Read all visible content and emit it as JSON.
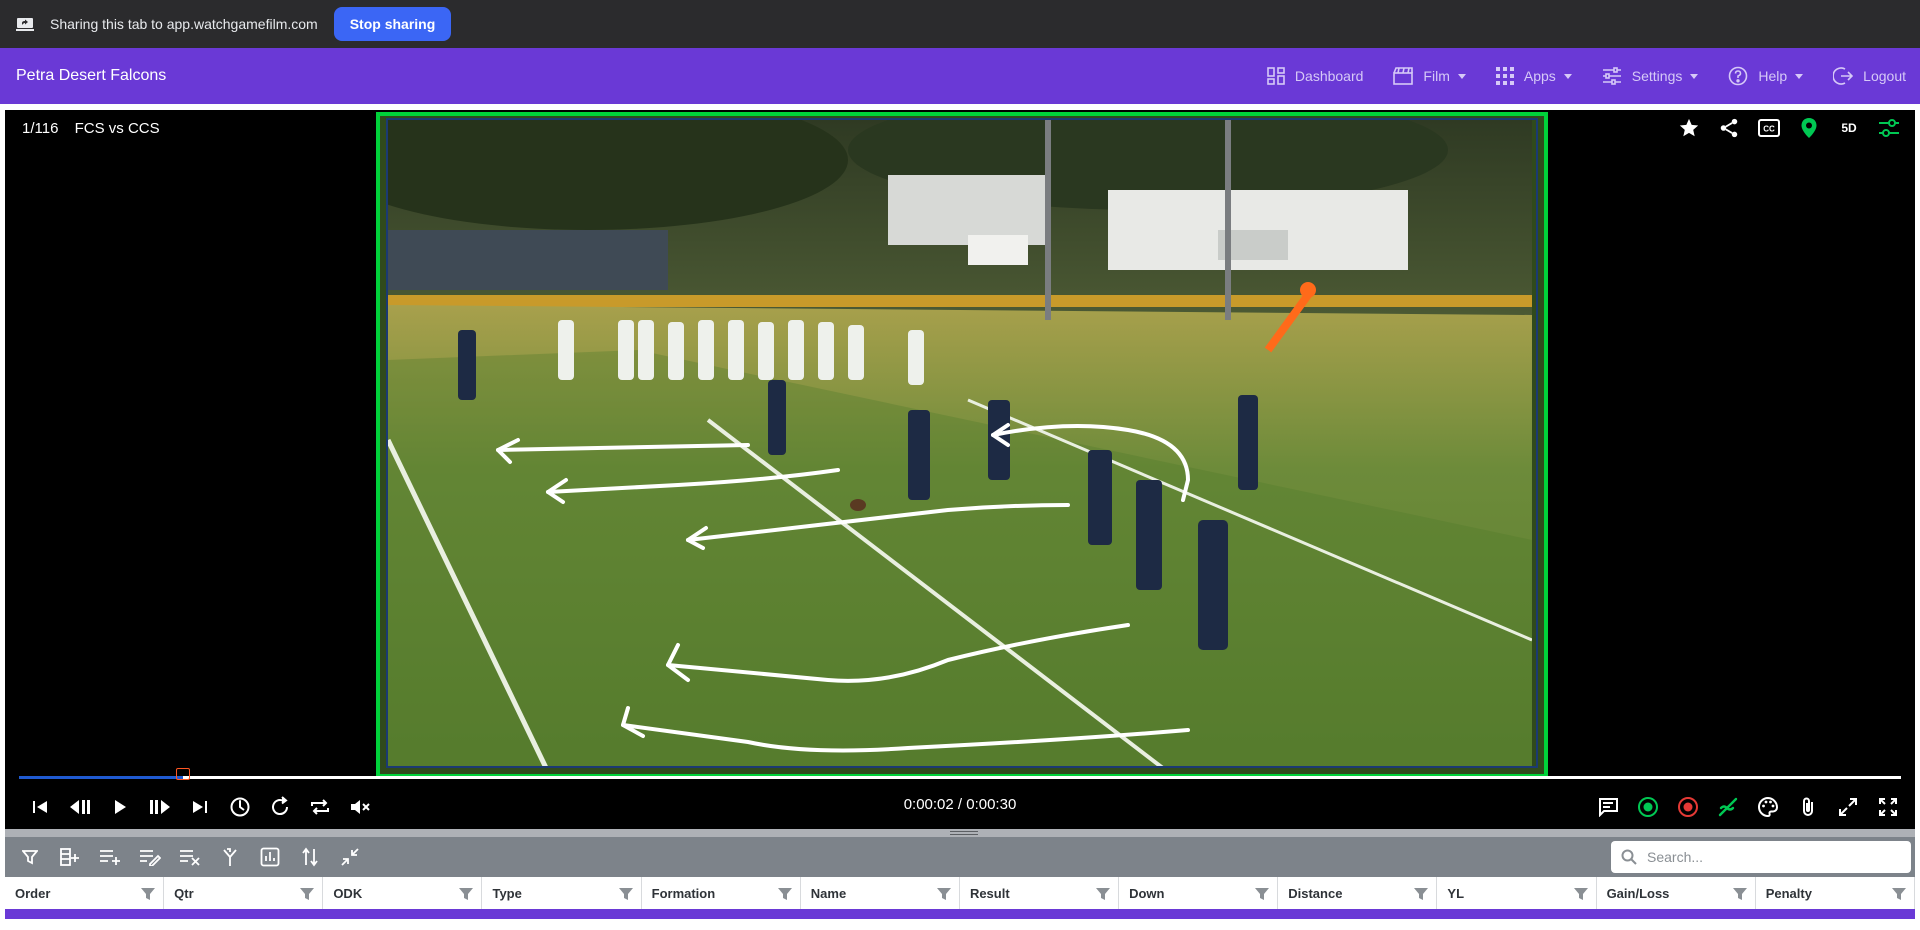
{
  "share_bar": {
    "text": "Sharing this tab to app.watchgamefilm.com",
    "stop_label": "Stop sharing"
  },
  "navbar": {
    "brand": "Petra Desert Falcons",
    "items": [
      {
        "label": "Dashboard",
        "icon": "dashboard-icon",
        "dropdown": false
      },
      {
        "label": "Film",
        "icon": "clapperboard-icon",
        "dropdown": true
      },
      {
        "label": "Apps",
        "icon": "apps-grid-icon",
        "dropdown": true
      },
      {
        "label": "Settings",
        "icon": "sliders-icon",
        "dropdown": true
      },
      {
        "label": "Help",
        "icon": "help-icon",
        "dropdown": true
      },
      {
        "label": "Logout",
        "icon": "logout-icon",
        "dropdown": false
      }
    ]
  },
  "player": {
    "clip_position": "1/116",
    "game_title": "FCS vs CCS",
    "time_display": "0:00:02 / 0:00:30",
    "progress_fraction": 0.087,
    "top_icons": [
      "star-icon",
      "share-icon",
      "closed-captions-icon",
      "location-pin-icon",
      "5d-icon",
      "adjust-icon"
    ],
    "top_icon_5d_text": "5D",
    "left_controls": [
      "skip-previous-icon",
      "step-back-icon",
      "play-icon",
      "step-forward-icon",
      "skip-next-icon",
      "speed-icon",
      "replay-icon",
      "loop-icon",
      "mute-icon"
    ],
    "right_controls": [
      "comment-icon",
      "record-start-icon",
      "record-stop-icon",
      "draw-icon",
      "palette-icon",
      "attachment-icon",
      "expand-icon",
      "fullscreen-icon"
    ],
    "colors": {
      "accent_green": "#00d23a",
      "accent_red": "#e53935",
      "progress_blue": "#1f5ad0"
    }
  },
  "grid": {
    "toolbar_icons": [
      "filter-icon",
      "add-column-icon",
      "add-row-icon",
      "edit-rows-icon",
      "clear-rows-icon",
      "merge-icon",
      "stats-icon",
      "sort-icon",
      "collapse-icon"
    ],
    "search_placeholder": "Search...",
    "columns": [
      "Order",
      "Qtr",
      "ODK",
      "Type",
      "Formation",
      "Name",
      "Result",
      "Down",
      "Distance",
      "YL",
      "Gain/Loss",
      "Penalty"
    ]
  },
  "colors": {
    "brand_purple": "#6a39d6",
    "share_bar": "#2b2b2d",
    "stop_button": "#3b66f5"
  }
}
